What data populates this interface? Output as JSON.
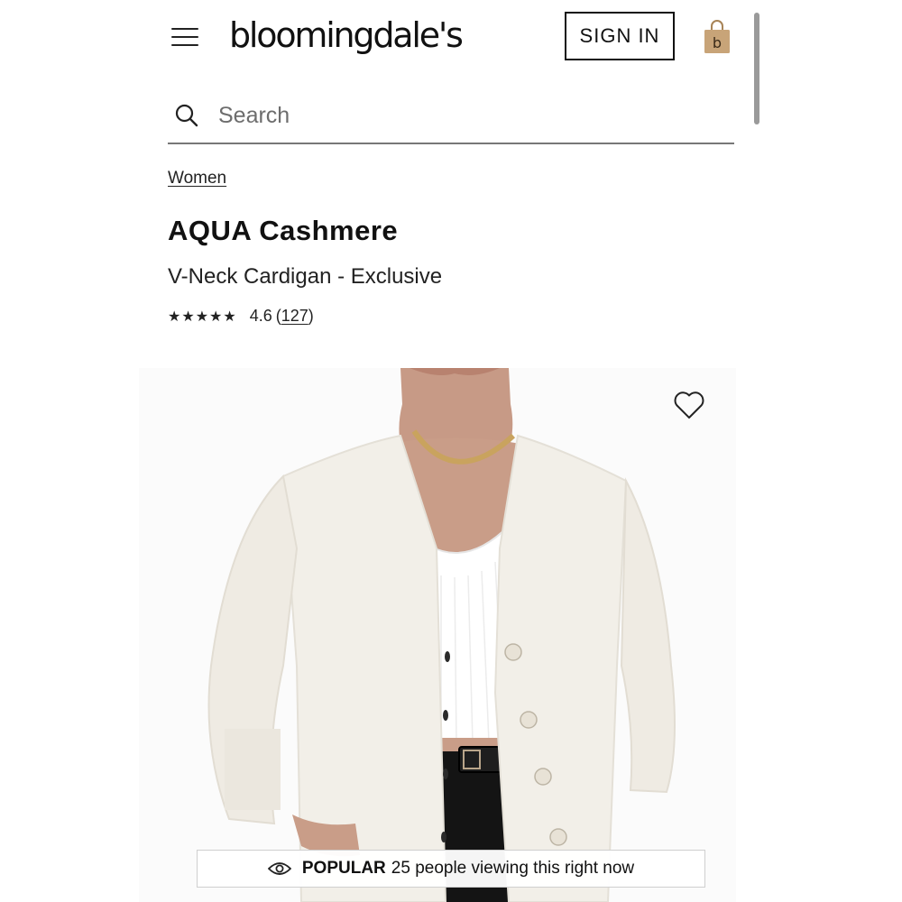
{
  "header": {
    "logo_text": "bloomingdale's",
    "signin_label": "SIGN IN",
    "menu_icon": "hamburger-menu-icon",
    "bag_icon": "shopping-bag-icon",
    "bag_letter": "b",
    "bag_color": "#c8a478"
  },
  "search": {
    "placeholder": "Search",
    "icon": "search-icon"
  },
  "breadcrumb": "Women",
  "product": {
    "brand": "AQUA Cashmere",
    "name": "V-Neck Cardigan - Exclusive",
    "stars_display": "★★★★★",
    "rating": 4.6,
    "rating_text": "4.6",
    "paren_open": "(",
    "review_count": "127",
    "paren_close": ")",
    "wishlist_icon": "heart-outline-icon",
    "image_description_icon": "product-photo"
  },
  "popular_banner": {
    "icon": "eye-icon",
    "label": "POPULAR",
    "text": "25 people viewing this right now"
  }
}
